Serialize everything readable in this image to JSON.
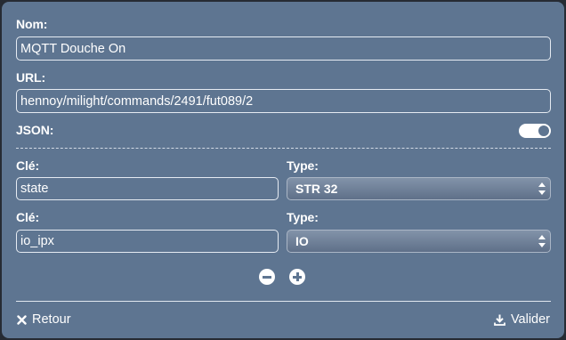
{
  "form": {
    "nom": {
      "label": "Nom:",
      "value": "MQTT Douche On"
    },
    "url": {
      "label": "URL:",
      "value": "hennoy/milight/commands/2491/fut089/2"
    },
    "json": {
      "label": "JSON:",
      "enabled": true
    },
    "params": [
      {
        "key_label": "Clé:",
        "key_value": "state",
        "type_label": "Type:",
        "type_value": "STR 32"
      },
      {
        "key_label": "Clé:",
        "key_value": "io_ipx",
        "type_label": "Type:",
        "type_value": "IO"
      }
    ]
  },
  "footer": {
    "back_label": "Retour",
    "submit_label": "Valider"
  },
  "icons": {
    "remove": "minus-circle-icon",
    "add": "plus-circle-icon",
    "back": "close-icon",
    "submit": "download-icon"
  },
  "colors": {
    "panel_background": "#5e7591",
    "text": "#ffffff"
  }
}
